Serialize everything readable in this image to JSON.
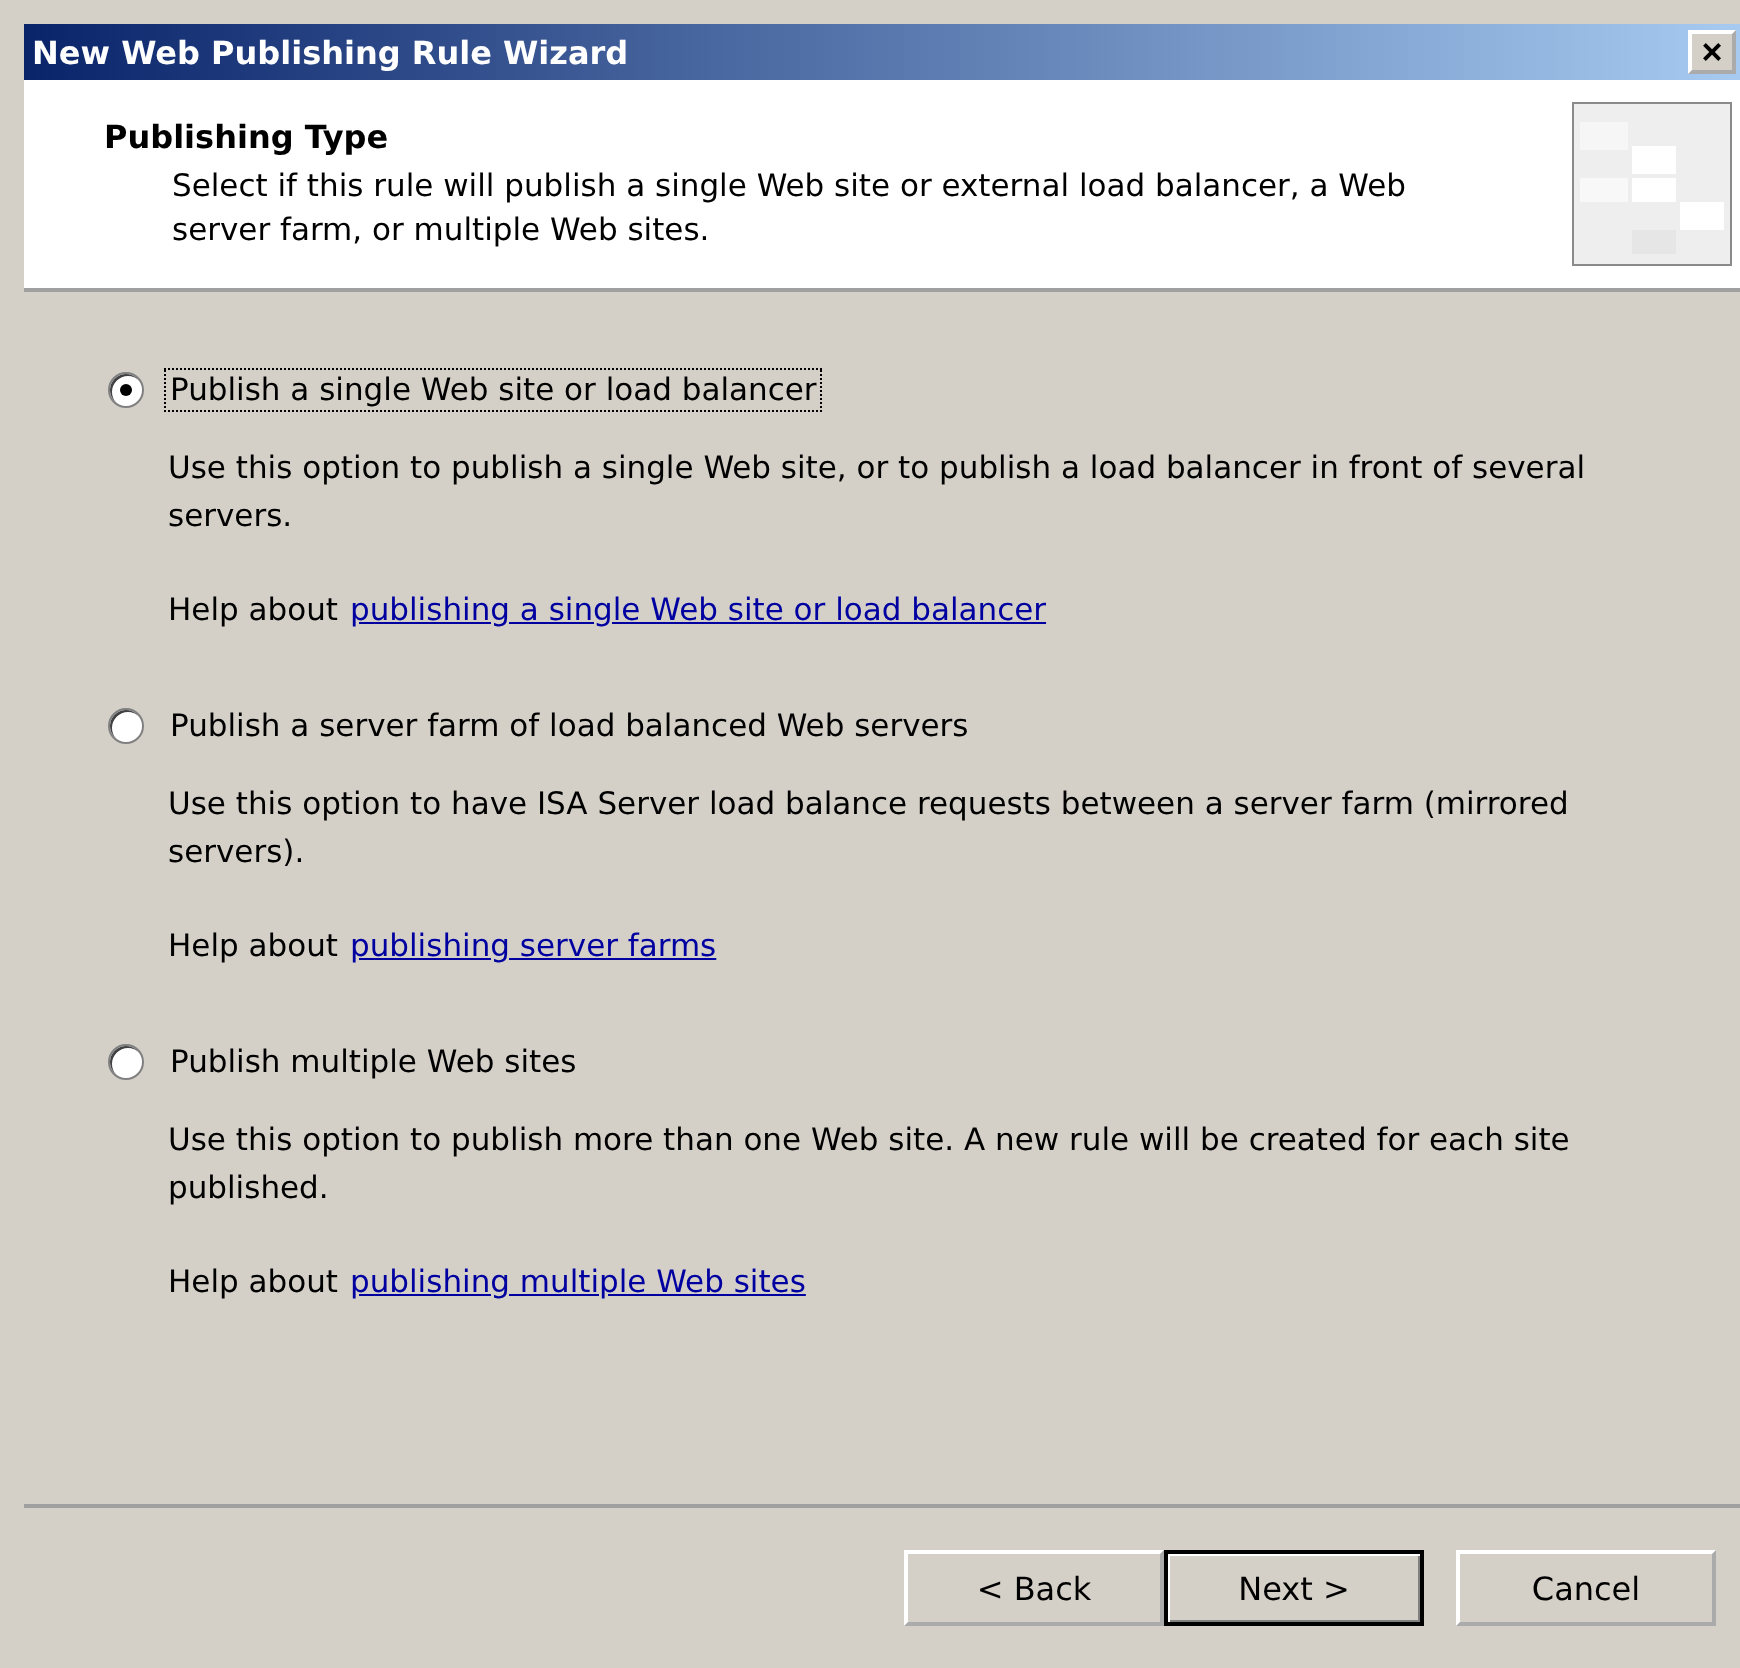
{
  "window": {
    "title": "New Web Publishing Rule Wizard",
    "close": "×"
  },
  "header": {
    "title": "Publishing Type",
    "description": "Select if this rule will publish a single Web site or external load balancer, a Web server farm, or multiple Web sites."
  },
  "options": [
    {
      "label": "Publish a single Web site or load balancer",
      "selected": true,
      "description": "Use this option to publish a single Web site, or to publish a load balancer in front of several servers.",
      "help_prefix": "Help about",
      "help_link": "publishing a single Web site or load balancer"
    },
    {
      "label": "Publish a server farm of load balanced Web servers",
      "selected": false,
      "description": "Use this option to have ISA Server load balance requests between a server farm (mirrored servers).",
      "help_prefix": "Help about",
      "help_link": "publishing server farms"
    },
    {
      "label": "Publish multiple Web sites",
      "selected": false,
      "description": "Use this option to publish more than one Web site. A new rule will be created for each site published.",
      "help_prefix": "Help about",
      "help_link": "publishing multiple Web sites"
    }
  ],
  "buttons": [
    {
      "label": "< Back",
      "default": false
    },
    {
      "label": "Next >",
      "default": true
    },
    {
      "label": "Cancel",
      "default": false
    }
  ]
}
